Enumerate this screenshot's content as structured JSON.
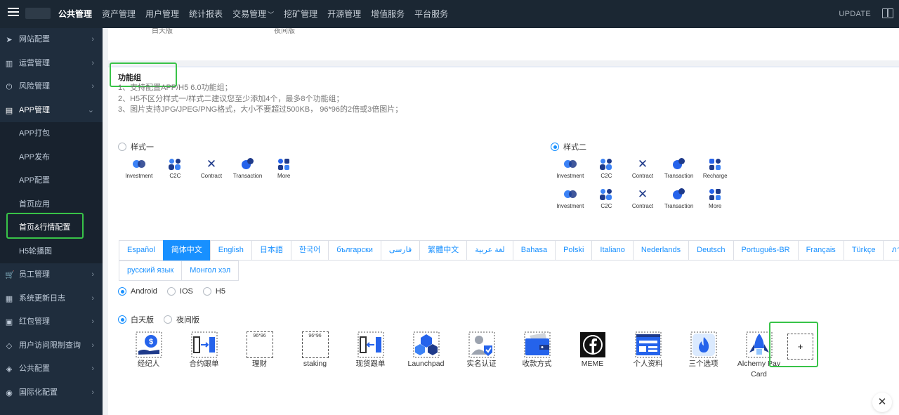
{
  "topbar": {
    "nav": [
      {
        "label": "公共管理",
        "active": true
      },
      {
        "label": "资产管理"
      },
      {
        "label": "用户管理"
      },
      {
        "label": "统计报表"
      },
      {
        "label": "交易管理",
        "caret": true
      },
      {
        "label": "挖矿管理"
      },
      {
        "label": "开源管理"
      },
      {
        "label": "增值服务"
      },
      {
        "label": "平台服务"
      }
    ],
    "update": "UPDATE"
  },
  "sidebar": {
    "items": [
      {
        "label": "网站配置",
        "icon": "send-icon",
        "glyph": "➤"
      },
      {
        "label": "运营管理",
        "icon": "bar-chart-icon",
        "glyph": "▥"
      },
      {
        "label": "风险管理",
        "icon": "power-icon",
        "glyph": "⏻"
      },
      {
        "label": "APP管理",
        "icon": "book-icon",
        "glyph": "▤",
        "open": true
      },
      {
        "label": "员工管理",
        "icon": "cart-icon",
        "glyph": "🛒"
      },
      {
        "label": "系统更新日志",
        "icon": "grid-icon",
        "glyph": "▦"
      },
      {
        "label": "红包管理",
        "icon": "gift-icon",
        "glyph": "▣"
      },
      {
        "label": "用户访问限制查询",
        "icon": "diamond-icon",
        "glyph": "◇"
      },
      {
        "label": "公共配置",
        "icon": "tag-icon",
        "glyph": "◈"
      },
      {
        "label": "国际化配置",
        "icon": "globe-icon",
        "glyph": "◉"
      }
    ],
    "sub": [
      {
        "label": "APP打包"
      },
      {
        "label": "APP发布"
      },
      {
        "label": "APP配置"
      },
      {
        "label": "首页应用"
      },
      {
        "label": "首页&行情配置",
        "active": true
      },
      {
        "label": "H5轮播图"
      }
    ]
  },
  "top_card": {
    "left_cut": "白天版",
    "right_cut": "夜间版"
  },
  "section": {
    "title": "功能组",
    "notes": [
      "1、支持配置APP/H5 6.0功能组；",
      "2、H5不区分样式一/样式二建议您至少添加4个，最多8个功能组；",
      "3、图片支持JPG/JPEG/PNG格式，大小不要超过500KB， 96*96的2倍或3倍图片；"
    ]
  },
  "style_one": {
    "label": "样式一",
    "selected": false,
    "items": [
      "Investment",
      "C2C",
      "Contract",
      "Transaction",
      "More"
    ]
  },
  "style_two": {
    "label": "样式二",
    "selected": true,
    "row1": [
      "Investment",
      "C2C",
      "Contract",
      "Transaction",
      "Recharge"
    ],
    "row2": [
      "Investment",
      "C2C",
      "Contract",
      "Transaction",
      "More"
    ]
  },
  "languages": {
    "row1": [
      "Español",
      "简体中文",
      "English",
      "日本語",
      "한국어",
      "български",
      "فارسی",
      "繁體中文",
      "لغة عربية",
      "Bahasa",
      "Polski",
      "Italiano",
      "Nederlands",
      "Deutsch",
      "Português-BR",
      "Français",
      "Türkçe",
      "ภาษาไ"
    ],
    "row2": [
      "русский язык",
      "Монгол хэл"
    ],
    "active": "简体中文"
  },
  "platforms": {
    "options": [
      "Android",
      "IOS",
      "H5"
    ],
    "selected": "Android"
  },
  "modes": {
    "options": [
      "白天版",
      "夜间版"
    ],
    "selected": "白天版"
  },
  "functions": {
    "items": [
      {
        "label": "经纪人",
        "icon": "broker-icon"
      },
      {
        "label": "合约跟单",
        "icon": "contract-follow-icon"
      },
      {
        "label": "理财",
        "icon": "placeholder-icon",
        "placeholder": "96*96"
      },
      {
        "label": "staking",
        "icon": "placeholder-icon",
        "placeholder": "96*96"
      },
      {
        "label": "现货跟单",
        "icon": "spot-follow-icon"
      },
      {
        "label": "Launchpad",
        "icon": "launchpad-icon"
      },
      {
        "label": "实名认证",
        "icon": "verify-icon"
      },
      {
        "label": "收款方式",
        "icon": "wallet-icon"
      },
      {
        "label": "MEME",
        "icon": "facebook-icon"
      },
      {
        "label": "个人资料",
        "icon": "profile-icon"
      },
      {
        "label": "三个选项",
        "icon": "flame-icon"
      },
      {
        "label": "Alchemy Pay Card",
        "icon": "rocket-icon"
      }
    ],
    "add_label": "+"
  },
  "close_label": "✕",
  "colors": {
    "accent": "#1890ff",
    "highlight": "#38c348",
    "sidebar": "#1f2d3d",
    "topbar": "#1b2733"
  }
}
